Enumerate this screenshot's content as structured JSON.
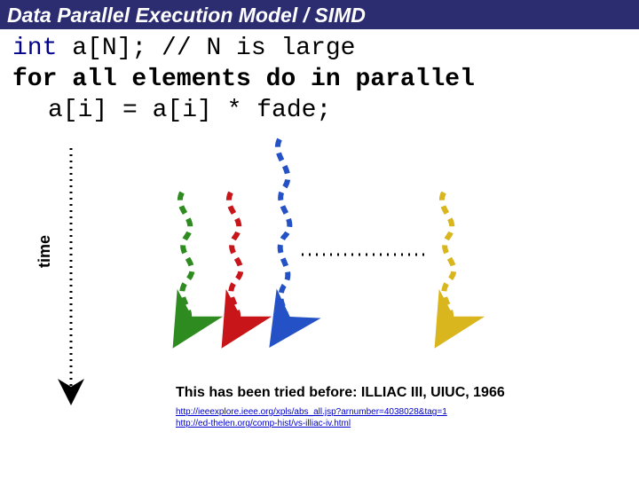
{
  "title": "Data Parallel Execution Model / SIMD",
  "code": {
    "l1a": "int",
    "l1b": " a[N]; // N is large",
    "l2": "for all elements do in parallel",
    "l3": "a[i] = a[i] * fade;"
  },
  "axis": {
    "time": "time"
  },
  "note": "This has been tried before: ILLIAC III, UIUC, 1966",
  "links": {
    "u1": "http://ieeexplore.ieee.org/xpls/abs_all.jsp?arnumber=4038028&tag=1",
    "u2": "http://ed-thelen.org/comp-hist/vs-illiac-iv.html"
  },
  "colors": {
    "green": "#2e8b1f",
    "red": "#c8151a",
    "blue": "#2452c6",
    "yellow": "#d9b51e",
    "black": "#000000"
  }
}
